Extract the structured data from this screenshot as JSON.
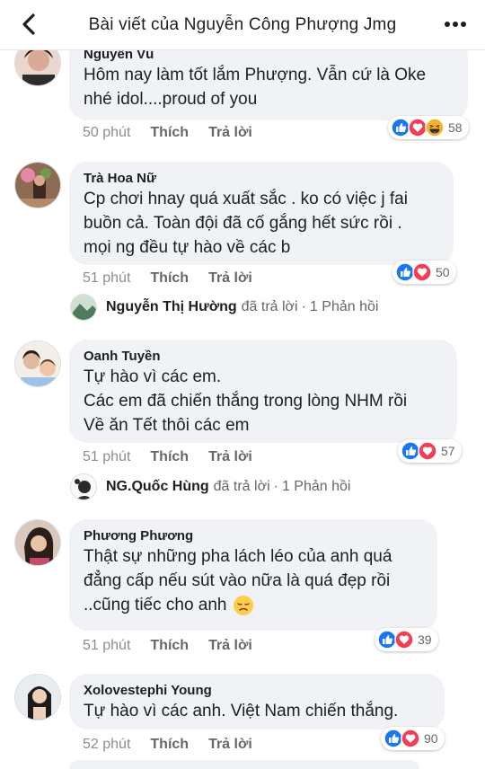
{
  "header": {
    "title": "Bài viết của Nguyễn Công Phượng Jmg",
    "back_icon": "chevron-left-icon",
    "more_icon": "more-horizontal-icon"
  },
  "colors": {
    "like_blue": "#1877f2",
    "love_red": "#f33e58",
    "haha_yellow": "#f7b125",
    "bubble_gray": "#f0f2f5",
    "meta_gray": "#65676b"
  },
  "actions": {
    "like": "Thích",
    "reply": "Trả lời"
  },
  "comments": [
    {
      "author": "Nguyễn Vũ",
      "lines": [
        "Hôm nay làm tốt lắm Phượng. Vẫn cứ là Oke",
        "nhé idol....proud of you"
      ],
      "time": "50 phút",
      "reactions": [
        "like",
        "love",
        "haha"
      ],
      "reaction_count": "58"
    },
    {
      "author": "Trà Hoa Nữ",
      "lines": [
        "Cp chơi hnay quá xuất sắc . ko có việc j fai",
        "buồn cả. Toàn đội đã cố gắng hết sức rồi .",
        "mọi ng đều tự hào về các b"
      ],
      "time": "51 phút",
      "reactions": [
        "like",
        "love"
      ],
      "reaction_count": "50",
      "reply": {
        "name": "Nguyễn Thị Hường",
        "action": "đã trả lời",
        "sep": "·",
        "count": "1 Phản hồi"
      }
    },
    {
      "author": "Oanh Tuyền",
      "lines": [
        "Tự hào vì các em.",
        "Các em đã chiến thắng trong lòng NHM rồi",
        "Về ăn Tết thôi các em"
      ],
      "time": "51 phút",
      "reactions": [
        "like",
        "love"
      ],
      "reaction_count": "57",
      "reply": {
        "name": "NG.Quốc Hùng",
        "action": "đã trả lời",
        "sep": "·",
        "count": "1 Phản hồi"
      }
    },
    {
      "author": "Phương Phương",
      "lines": [
        "Thật sự những pha lách léo của anh quá",
        "đẳng cấp nếu sút vào nữa là quá đẹp rồi",
        "..cũng tiếc cho anh"
      ],
      "emoji_icon": "disappointed-face-icon",
      "time": "51 phút",
      "reactions": [
        "like",
        "love"
      ],
      "reaction_count": "39"
    },
    {
      "author": "Xolovestephi Young",
      "lines": [
        "Tự hào vì các anh. Việt Nam chiến thắng."
      ],
      "time": "52 phút",
      "reactions": [
        "like",
        "love"
      ],
      "reaction_count": "90"
    }
  ]
}
